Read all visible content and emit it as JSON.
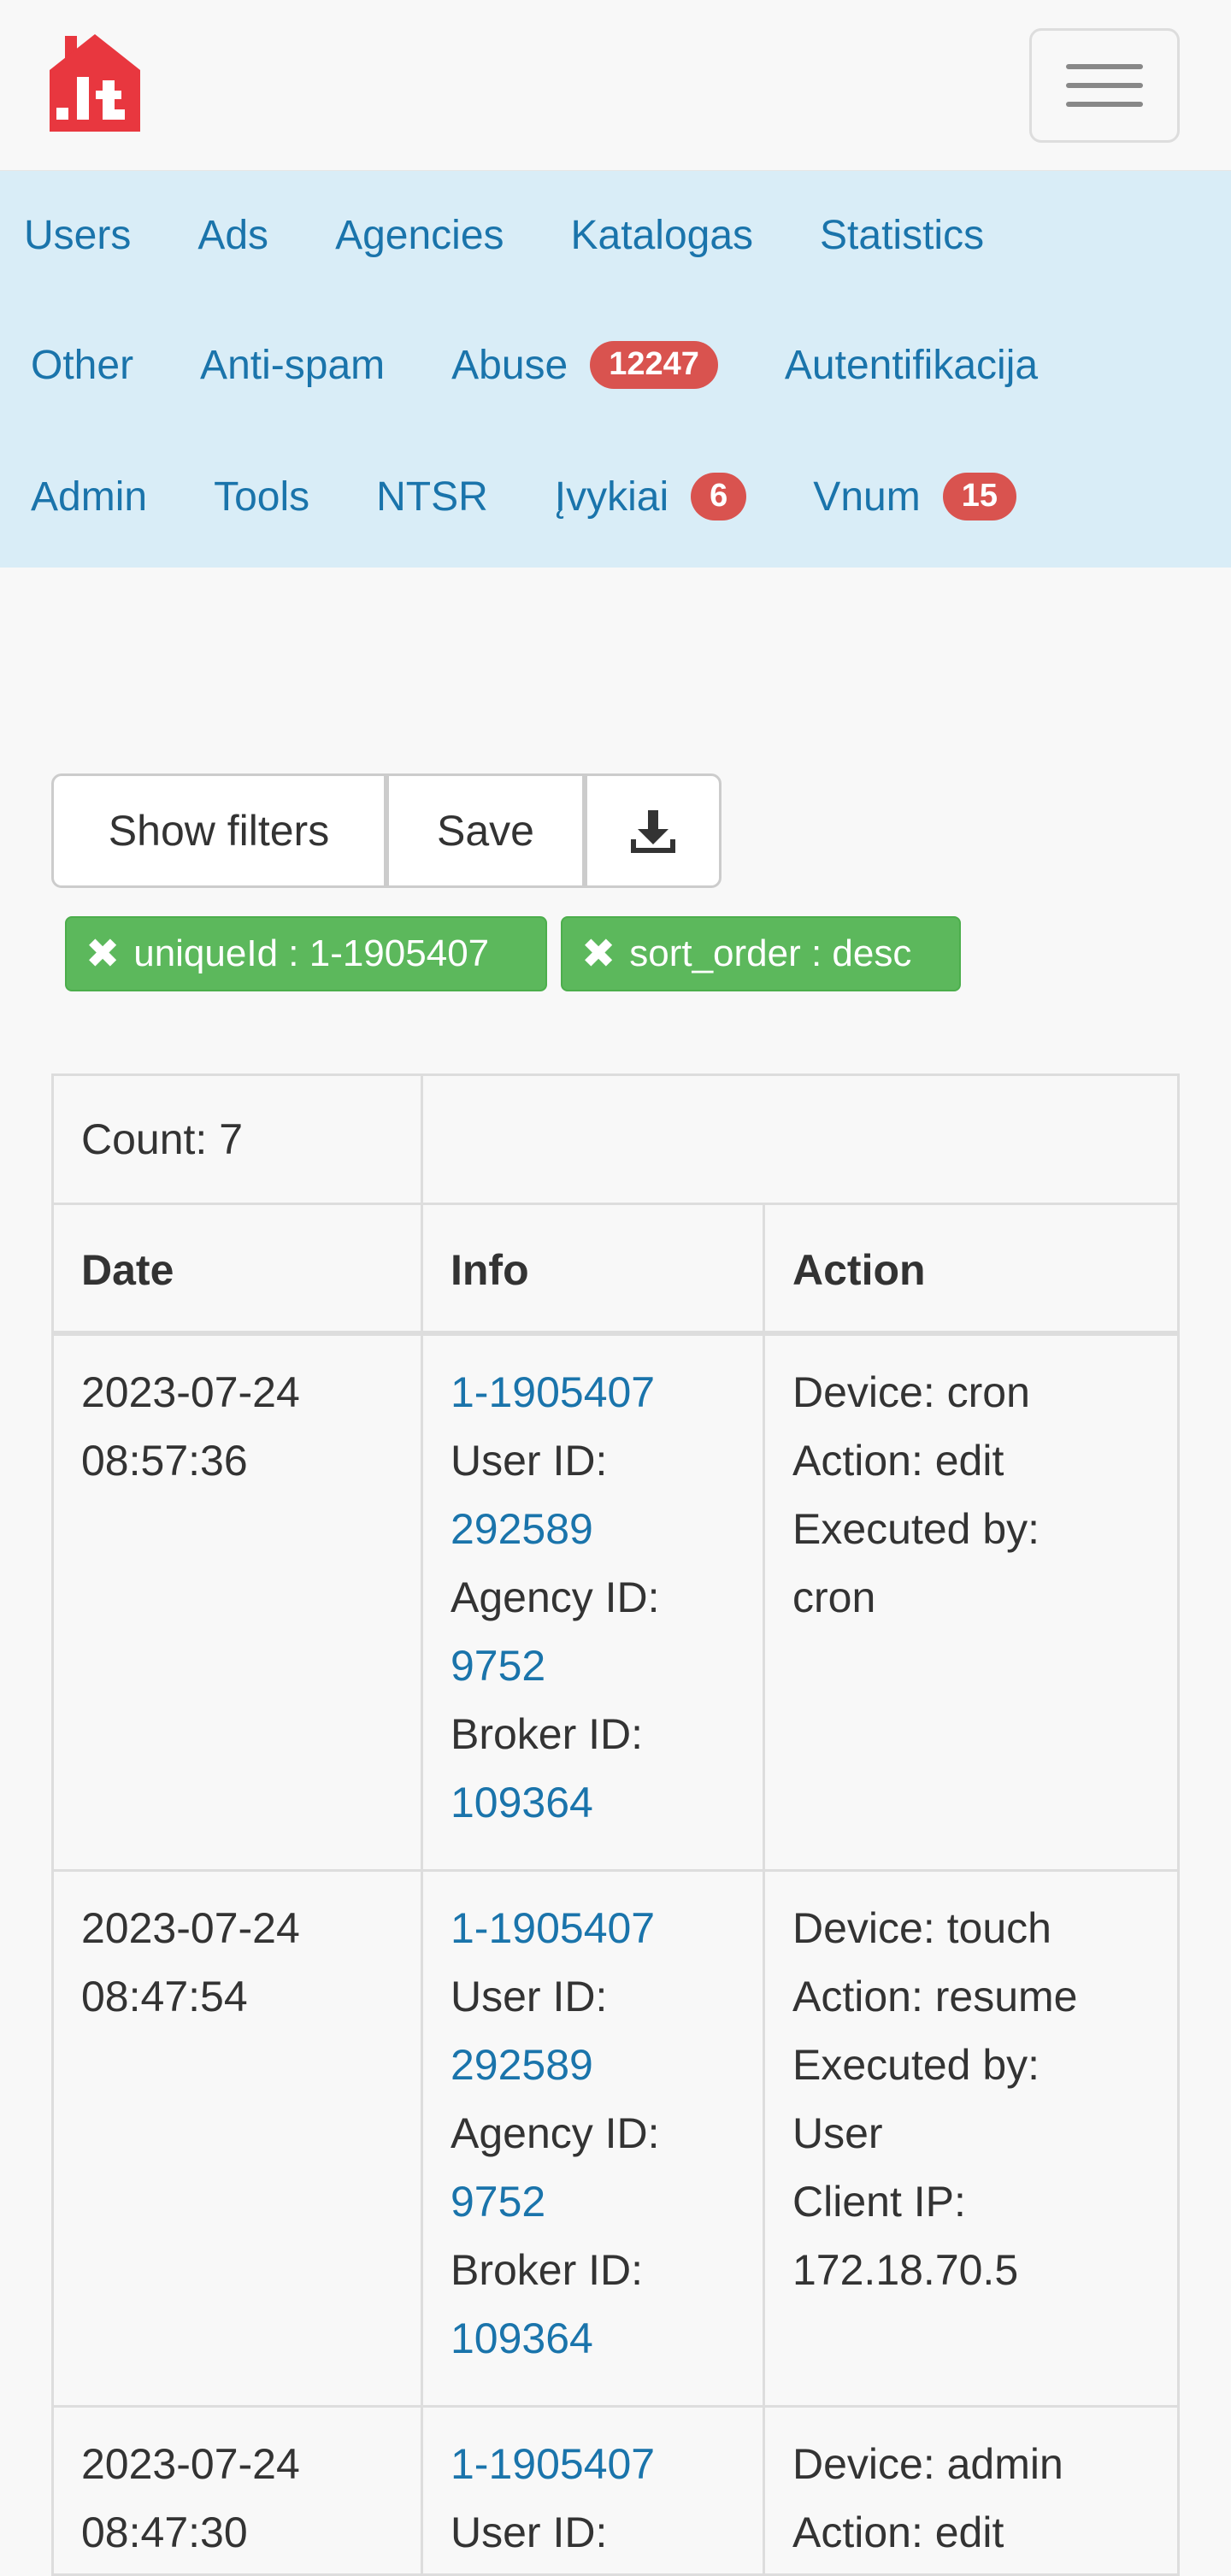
{
  "header": {
    "logo_text": ".lt",
    "brand_color": "#e8373f"
  },
  "nav": {
    "row1": [
      {
        "label": "Users"
      },
      {
        "label": "Ads"
      },
      {
        "label": "Agencies"
      },
      {
        "label": "Katalogas"
      },
      {
        "label": "Statistics"
      }
    ],
    "row2": [
      {
        "label": "Other"
      },
      {
        "label": "Anti-spam"
      },
      {
        "label": "Abuse",
        "badge": "12247"
      },
      {
        "label": "Autentifikacija"
      }
    ],
    "row3": [
      {
        "label": "Admin"
      },
      {
        "label": "Tools"
      },
      {
        "label": "NTSR"
      },
      {
        "label": "Įvykiai",
        "badge": "6"
      },
      {
        "label": "Vnum",
        "badge": "15"
      }
    ]
  },
  "toolbar": {
    "show_filters_label": "Show filters",
    "save_label": "Save",
    "download_icon": "download-icon"
  },
  "filters": {
    "chip1": "uniqueId : 1-1905407",
    "chip2": "sort_order : desc",
    "remove_glyph": "✖"
  },
  "table": {
    "count_label": "Count: 7",
    "headers": {
      "date": "Date",
      "info": "Info",
      "action": "Action"
    },
    "rows": [
      {
        "date": "2023-07-24",
        "time": "08:57:36",
        "unique_id": "1-1905407",
        "user_id_label": "User ID:",
        "user_id": "292589",
        "agency_id_label": "Agency ID:",
        "agency_id": "9752",
        "broker_id_label": "Broker ID:",
        "broker_id": "109364",
        "device": "Device: cron",
        "action": "Action: edit",
        "executed_by_label": "Executed by:",
        "executed_by": "cron"
      },
      {
        "date": "2023-07-24",
        "time": "08:47:54",
        "unique_id": "1-1905407",
        "user_id_label": "User ID:",
        "user_id": "292589",
        "agency_id_label": "Agency ID:",
        "agency_id": "9752",
        "broker_id_label": "Broker ID:",
        "broker_id": "109364",
        "device": "Device: touch",
        "action": "Action: resume",
        "executed_by_label": "Executed by:",
        "executed_by": "User",
        "client_ip_label": "Client IP:",
        "client_ip": "172.18.70.5"
      },
      {
        "date": "2023-07-24",
        "time": "08:47:30",
        "unique_id": "1-1905407",
        "user_id_label": "User ID:",
        "device": "Device: admin",
        "action": "Action: edit"
      }
    ]
  },
  "colors": {
    "nav_bg": "#d9edf7",
    "link": "#1a74ab",
    "badge": "#d9534f",
    "chip": "#5cb85c"
  }
}
